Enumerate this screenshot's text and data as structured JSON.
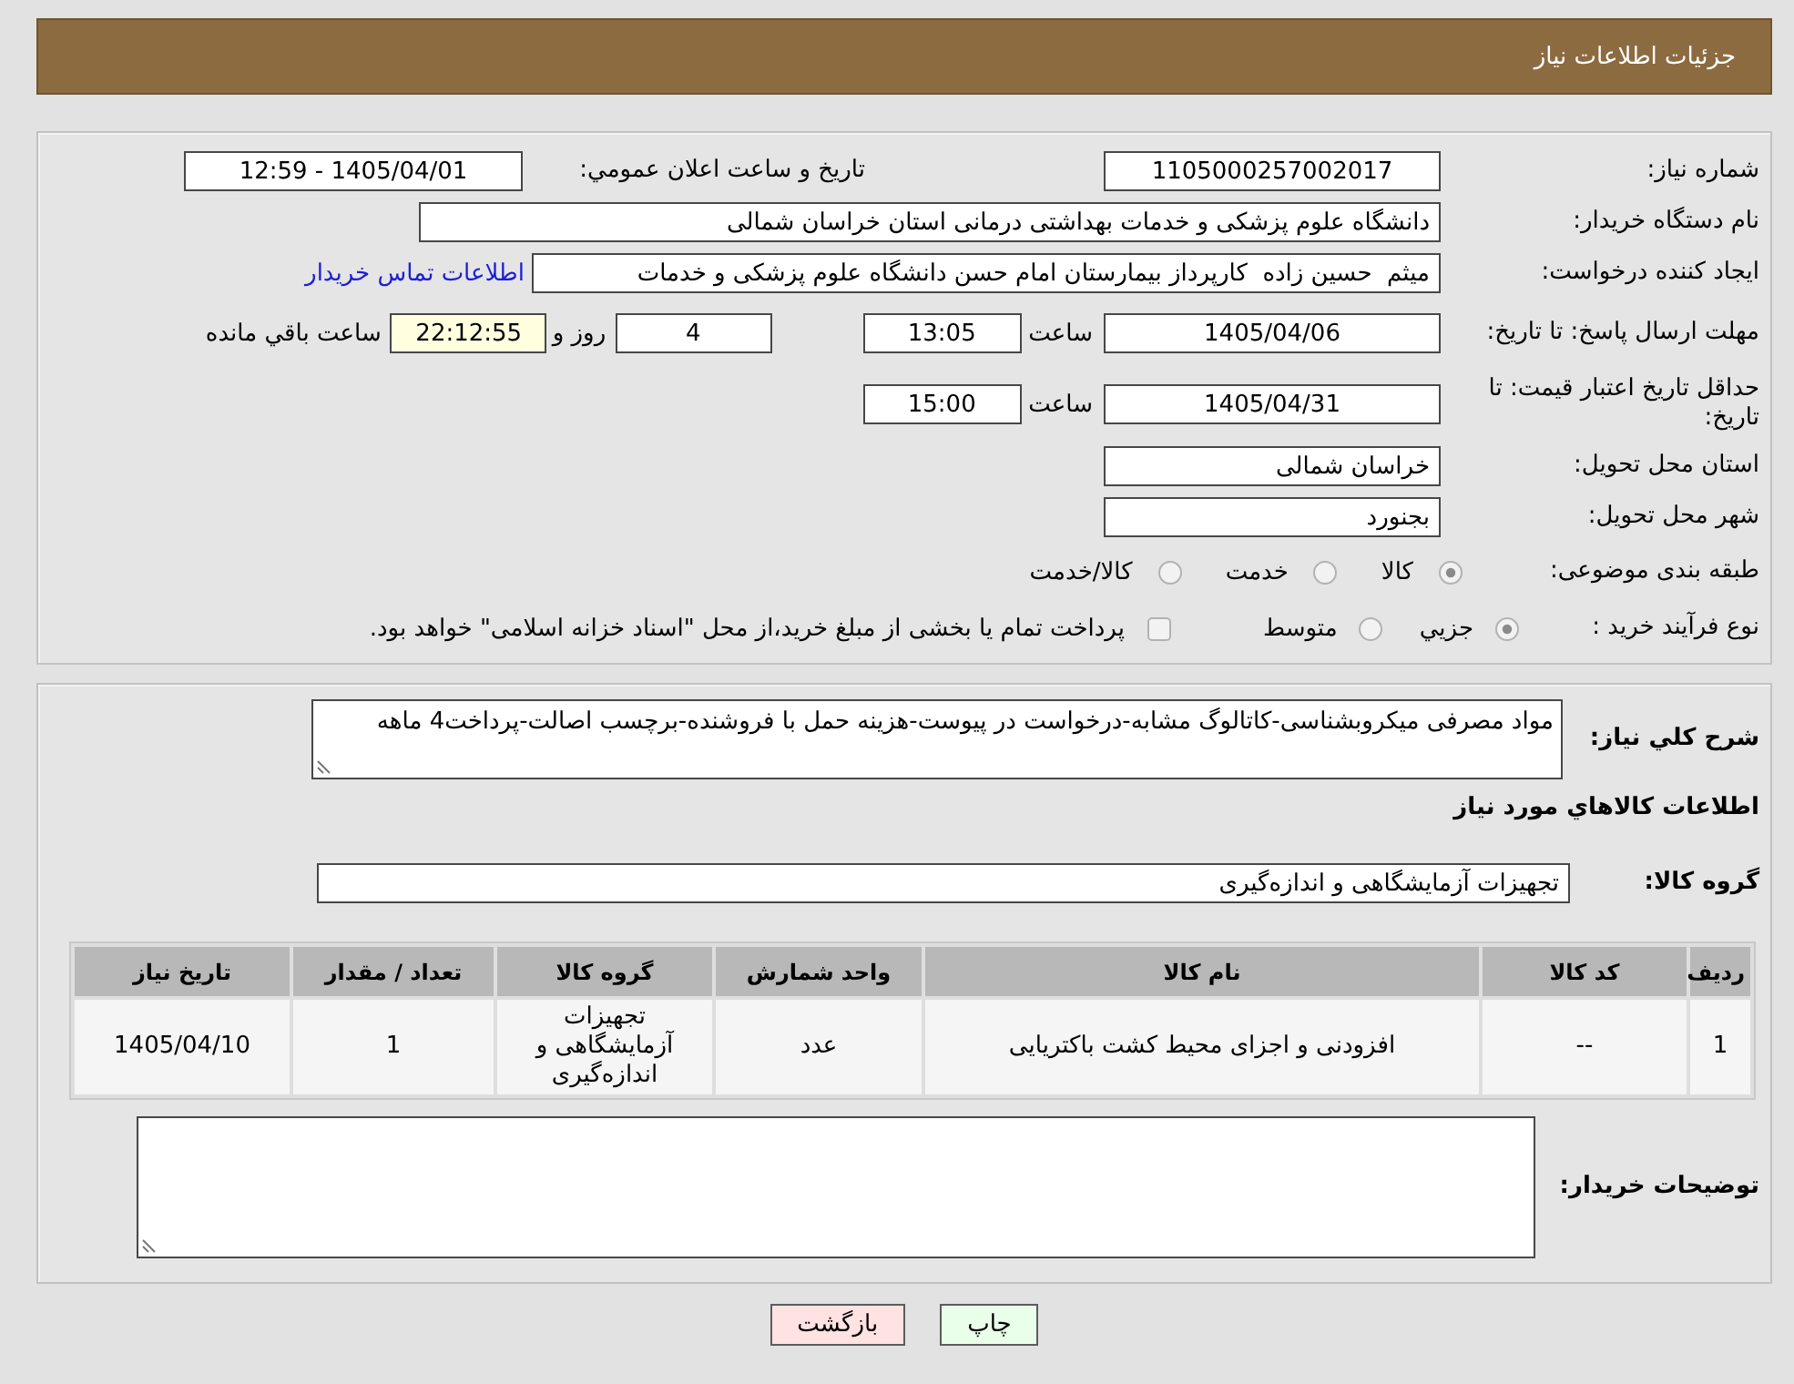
{
  "header": {
    "title": "جزئیات اطلاعات نیاز"
  },
  "details": {
    "need_number": {
      "label": "شماره نیاز:",
      "value": "1105000257002017"
    },
    "announcement": {
      "label": "تاریخ و ساعت اعلان عمومي:",
      "value": "1405/04/01 - 12:59"
    },
    "buyer_org": {
      "label": "نام دستگاه خریدار:",
      "value": "دانشگاه علوم پزشکی و خدمات بهداشتی درمانی استان خراسان شمالی"
    },
    "requester": {
      "label": "ایجاد کننده درخواست:",
      "value": "میثم  حسین زاده  کارپرداز بیمارستان امام حسن دانشگاه علوم پزشکی و خدمات",
      "link": "اطلاعات تماس خریدار"
    },
    "reply_deadline": {
      "label": "مهلت ارسال پاسخ: تا تاریخ:",
      "date": "1405/04/06",
      "time_label": "ساعت",
      "time": "13:05",
      "days": "4",
      "days_label": "روز و",
      "remaining": "22:12:55",
      "remaining_label": "ساعت باقي مانده"
    },
    "price_validity": {
      "label": "حداقل تاریخ اعتبار قیمت: تا تاریخ:",
      "date": "1405/04/31",
      "time_label": "ساعت",
      "time": "15:00"
    },
    "delivery_province": {
      "label": "استان محل تحویل:",
      "value": "خراسان شمالی"
    },
    "delivery_city": {
      "label": "شهر محل تحویل:",
      "value": "بجنورد"
    },
    "category": {
      "label": "طبقه بندی موضوعی:",
      "options": [
        {
          "label": "کالا",
          "selected": true
        },
        {
          "label": "خدمت",
          "selected": false
        },
        {
          "label": "کالا/خدمت",
          "selected": false
        }
      ]
    },
    "purchase_process": {
      "label": "نوع فرآیند خرید :",
      "options": [
        {
          "label": "جزيي",
          "selected": true
        },
        {
          "label": "متوسط",
          "selected": false
        }
      ],
      "treasury_option": {
        "label": "پرداخت تمام یا بخشی از مبلغ خرید،از محل \"اسناد خزانه اسلامی\" خواهد بود.",
        "checked": false
      }
    }
  },
  "requirements": {
    "description": {
      "label": "شرح کلي نیاز:",
      "value": "مواد مصرفی میکروبشناسی-کاتالوگ مشابه-درخواست در پیوست-هزینه حمل با فروشنده-برچسب اصالت-پرداخت4 ماهه"
    },
    "goods_title": "اطلاعات کالاهاي مورد نیاز",
    "goods_group": {
      "label": "گروه کالا:",
      "value": "تجهیزات آزمایشگاهی و اندازه‌گیری"
    },
    "table": {
      "columns": [
        "ردیف",
        "کد کالا",
        "نام کالا",
        "واحد شمارش",
        "گروه کالا",
        "تعداد / مقدار",
        "تاریخ نیاز"
      ],
      "rows": [
        {
          "cells": [
            "1",
            "--",
            "افزودنی و اجزای محیط کشت باکتریایی",
            "عدد",
            "تجهیزات آزمایشگاهی و اندازه‌گیری",
            "1",
            "1405/04/10"
          ]
        }
      ]
    },
    "buyer_notes": {
      "label": "توضیحات خریدار:"
    }
  },
  "buttons": [
    {
      "label": "چاپ",
      "kind": "print"
    },
    {
      "label": "بازگشت",
      "kind": "back"
    }
  ]
}
